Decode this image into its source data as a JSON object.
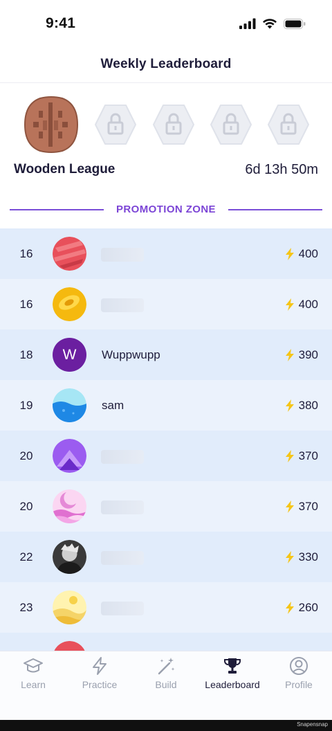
{
  "status": {
    "time": "9:41"
  },
  "header": {
    "title": "Weekly Leaderboard"
  },
  "league": {
    "name": "Wooden League",
    "timer": "6d 13h 50m",
    "badges": [
      {
        "icon": "wooden-league-badge",
        "locked": false,
        "color": "#b8735a"
      },
      {
        "icon": "lock-icon",
        "locked": true
      },
      {
        "icon": "lock-icon",
        "locked": true
      },
      {
        "icon": "lock-icon",
        "locked": true
      },
      {
        "icon": "lock-icon",
        "locked": true
      }
    ]
  },
  "zone": {
    "label": "PROMOTION ZONE",
    "color": "#7c45d6"
  },
  "rows": [
    {
      "rank": "16",
      "name": "",
      "score": "400",
      "avatar": "red-planet-avatar"
    },
    {
      "rank": "16",
      "name": "",
      "score": "400",
      "avatar": "yellow-planet-avatar"
    },
    {
      "rank": "18",
      "name": "Wuppwupp",
      "score": "390",
      "avatar": "letter-avatar",
      "initial": "W"
    },
    {
      "rank": "19",
      "name": "sam",
      "score": "380",
      "avatar": "ocean-avatar"
    },
    {
      "rank": "20",
      "name": "",
      "score": "370",
      "avatar": "purple-mountain-avatar"
    },
    {
      "rank": "20",
      "name": "",
      "score": "370",
      "avatar": "pink-moon-avatar"
    },
    {
      "rank": "22",
      "name": "",
      "score": "330",
      "avatar": "photo-avatar"
    },
    {
      "rank": "23",
      "name": "",
      "score": "260",
      "avatar": "sand-avatar"
    }
  ],
  "tabs": [
    {
      "label": "Learn",
      "icon": "graduation-cap-icon",
      "active": false
    },
    {
      "label": "Practice",
      "icon": "lightning-icon",
      "active": false
    },
    {
      "label": "Build",
      "icon": "magic-wand-icon",
      "active": false
    },
    {
      "label": "Leaderboard",
      "icon": "trophy-icon",
      "active": true
    },
    {
      "label": "Profile",
      "icon": "user-circle-icon",
      "active": false
    }
  ],
  "watermark": "Snapensnap",
  "colors": {
    "accent": "#7c45d6",
    "bolt": "#f5c518",
    "row_odd": "#e1ecfb",
    "row_even": "#ebf2fc"
  }
}
